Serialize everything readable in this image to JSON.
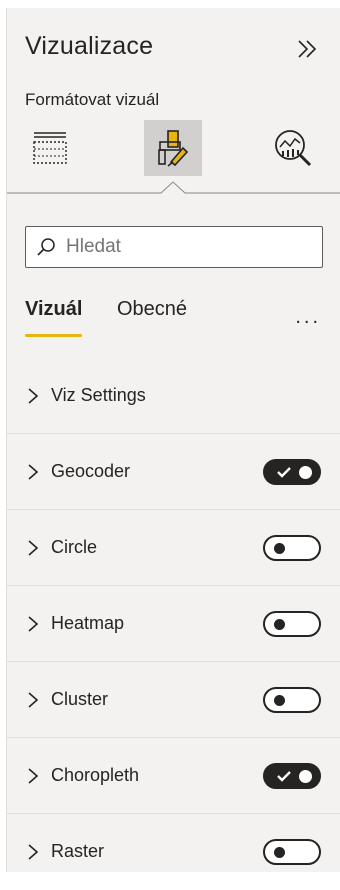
{
  "pane": {
    "title": "Vizualizace",
    "subtitle": "Formátovat vizuál"
  },
  "modes": [
    {
      "name": "build-visual",
      "icon": "table-fields-icon",
      "active": false
    },
    {
      "name": "format-visual",
      "icon": "paint-roller-icon",
      "active": true
    },
    {
      "name": "analytics",
      "icon": "magnifier-chart-icon",
      "active": false
    }
  ],
  "search": {
    "value": "",
    "placeholder": "Hledat"
  },
  "tabs": [
    {
      "label": "Vizuál",
      "active": true
    },
    {
      "label": "Obecné",
      "active": false
    }
  ],
  "more_label": "...",
  "sections": [
    {
      "label": "Viz Settings",
      "toggle": null
    },
    {
      "label": "Geocoder",
      "toggle": "on"
    },
    {
      "label": "Circle",
      "toggle": "off"
    },
    {
      "label": "Heatmap",
      "toggle": "off"
    },
    {
      "label": "Cluster",
      "toggle": "off"
    },
    {
      "label": "Choropleth",
      "toggle": "on"
    },
    {
      "label": "Raster",
      "toggle": "off"
    }
  ],
  "colors": {
    "accent_tab_underline": "#e8b413",
    "pane_background": "#f3f2f1",
    "active_mode_background": "#d2d0ce",
    "toggle_dark": "#252423"
  }
}
